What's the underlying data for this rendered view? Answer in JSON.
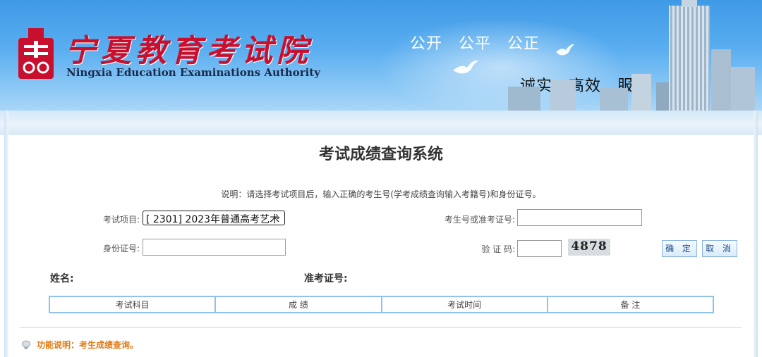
{
  "header": {
    "org_name_cn": "宁夏教育考试院",
    "org_name_en": "Ningxia Education Examinations Authority",
    "slogan_top": "公开　公平　公正",
    "slogan_bottom": "诚实　高效　服务"
  },
  "page": {
    "title": "考试成绩查询系统",
    "note": "说明：请选择考试项目后，输入正确的考生号(学考成绩查询输入考籍号)和身份证号。"
  },
  "form": {
    "exam_item_label": "考试项目:",
    "exam_item_value": "[ 2301] 2023年普通高考艺术",
    "candidate_no_label": "考生号或准考证号:",
    "candidate_no_value": "",
    "id_no_label": "身份证号:",
    "id_no_value": "",
    "captcha_label": "验 证 码:",
    "captcha_value": "",
    "captcha_image_text": "4878",
    "confirm_label": "确 定",
    "cancel_label": "取 消"
  },
  "result": {
    "name_label": "姓名:",
    "ticket_label": "准考证号:",
    "columns": [
      "考试科目",
      "成 绩",
      "考试时间",
      "备 注"
    ]
  },
  "footer": {
    "function_note": "功能说明：考生成绩查询。"
  },
  "colors": {
    "banner_blue": "#3f9ae6",
    "logo_red": "#c8102e",
    "table_border": "#8fc3ec",
    "accent_orange": "#e07a14",
    "button_text": "#1d4f86"
  }
}
